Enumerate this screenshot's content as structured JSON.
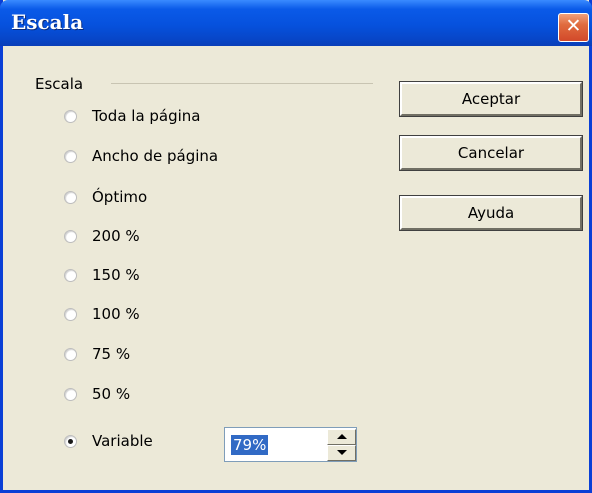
{
  "window": {
    "title": "Escala",
    "close_glyph": "✕"
  },
  "group": {
    "label": "Escala",
    "options": [
      {
        "label": "Toda la página",
        "checked": false
      },
      {
        "label": "Ancho de página",
        "checked": false
      },
      {
        "label": "Óptimo",
        "checked": false
      },
      {
        "label": "200 %",
        "checked": false
      },
      {
        "label": "150 %",
        "checked": false
      },
      {
        "label": "100 %",
        "checked": false
      },
      {
        "label": "75 %",
        "checked": false
      },
      {
        "label": "50 %",
        "checked": false
      },
      {
        "label": "Variable",
        "checked": true
      }
    ]
  },
  "variable": {
    "value": "79%"
  },
  "buttons": {
    "ok": "Aceptar",
    "cancel": "Cancelar",
    "help": "Ayuda"
  },
  "colors": {
    "titlebar": "#0651dd",
    "dialog_bg": "#ece9d8",
    "close": "#d2492a",
    "selection": "#316ac5"
  }
}
